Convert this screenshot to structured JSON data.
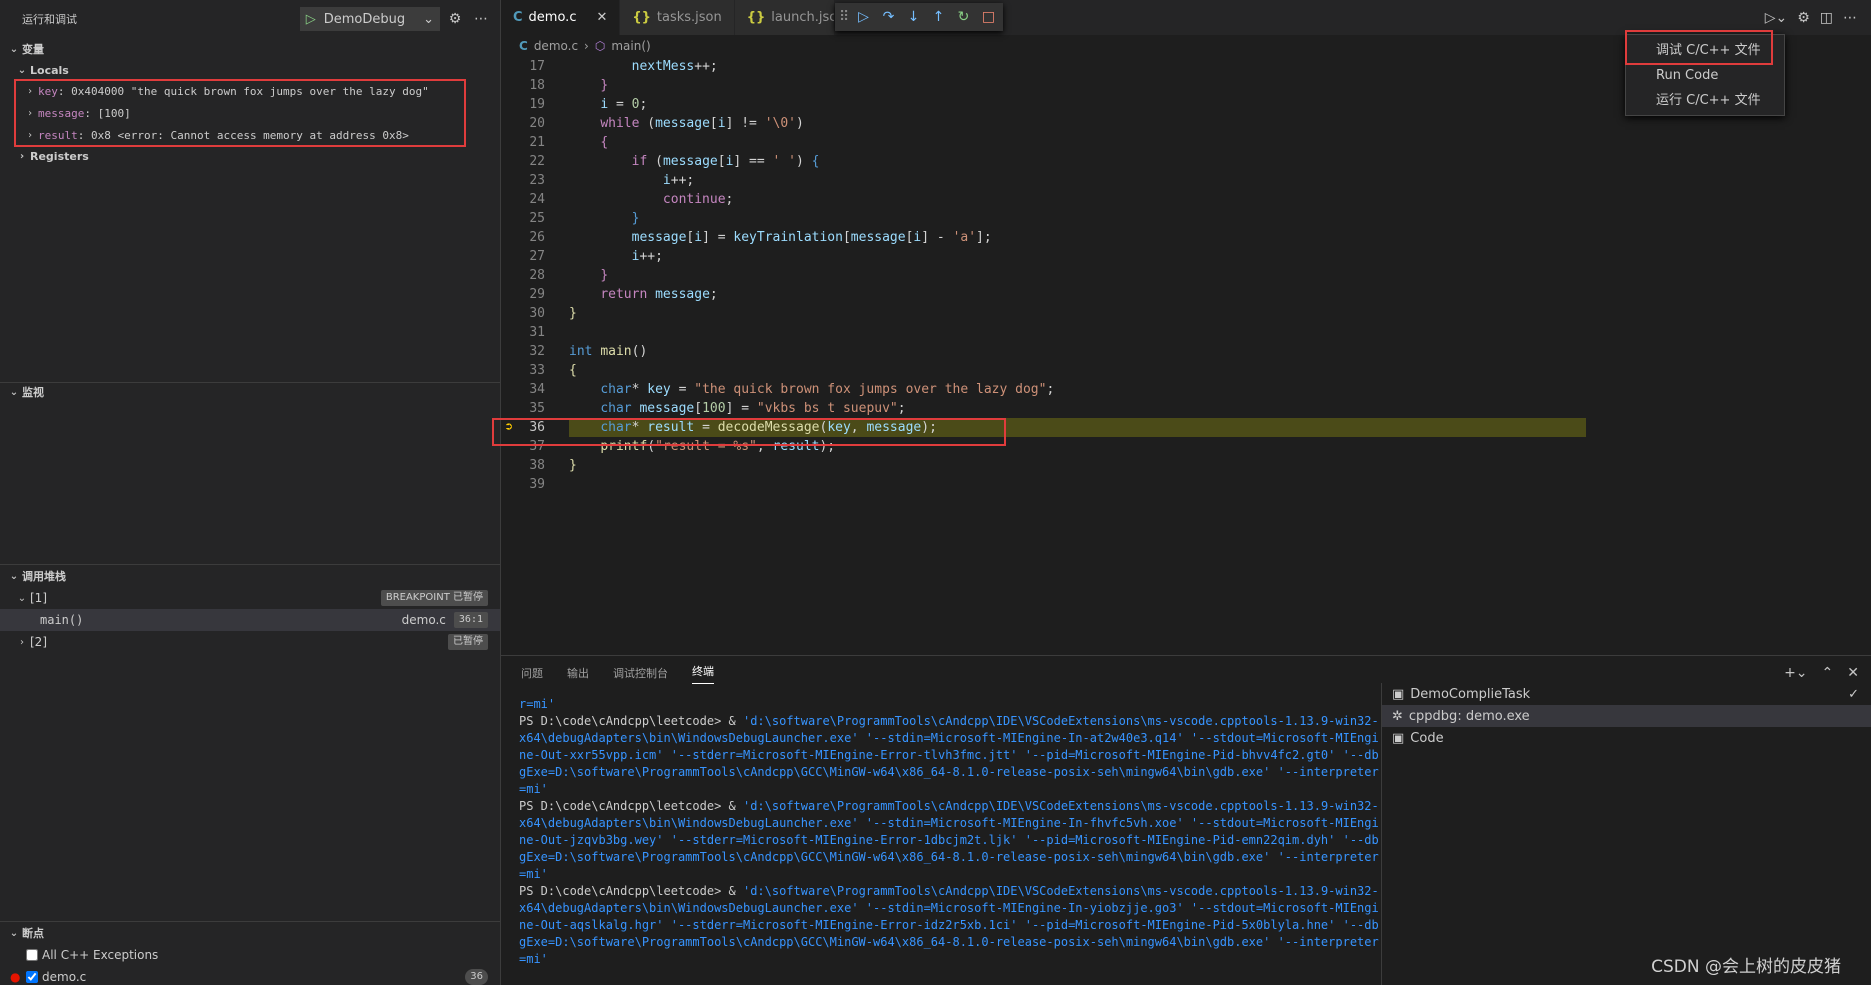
{
  "sidebar": {
    "title": "运行和调试",
    "config_name": "DemoDebug",
    "variables_header": "变量",
    "locals_label": "Locals",
    "locals": [
      {
        "name": "key",
        "value": "0x404000 \"the quick brown fox jumps over the lazy dog\""
      },
      {
        "name": "message",
        "value": "[100]"
      },
      {
        "name": "result",
        "value": "0x8 <error: Cannot access memory at address 0x8>"
      }
    ],
    "registers_label": "Registers",
    "watch_header": "监视",
    "callstack_header": "调用堆栈",
    "threads": [
      {
        "label": "[1]",
        "status": "BREAKPOINT 已暂停"
      },
      {
        "label": "[2]",
        "status": "已暂停"
      }
    ],
    "frame": {
      "name": "main()",
      "file": "demo.c",
      "pos": "36:1"
    },
    "breakpoints_header": "断点",
    "breakpoints": [
      {
        "label": "All C++ Exceptions",
        "checked": false
      },
      {
        "label": "demo.c",
        "checked": true,
        "count": "36"
      }
    ]
  },
  "tabs": [
    {
      "label": "demo.c"
    },
    {
      "label": "tasks.json"
    },
    {
      "label": "launch.jsc"
    }
  ],
  "breadcrumb": {
    "file": "demo.c",
    "symbol": "main()"
  },
  "code_lines": [
    {
      "n": "17"
    },
    {
      "n": "18"
    },
    {
      "n": "19"
    },
    {
      "n": "20"
    },
    {
      "n": "21"
    },
    {
      "n": "22"
    },
    {
      "n": "23"
    },
    {
      "n": "24"
    },
    {
      "n": "25"
    },
    {
      "n": "26"
    },
    {
      "n": "27"
    },
    {
      "n": "28"
    },
    {
      "n": "29"
    },
    {
      "n": "30"
    },
    {
      "n": "31"
    },
    {
      "n": "32"
    },
    {
      "n": "33"
    },
    {
      "n": "34"
    },
    {
      "n": "35"
    },
    {
      "n": "36"
    },
    {
      "n": "37"
    },
    {
      "n": "38"
    },
    {
      "n": "39"
    }
  ],
  "run_menu": {
    "items": [
      "调试 C/C++ 文件",
      "Run Code",
      "运行 C/C++ 文件"
    ]
  },
  "panel": {
    "tabs": [
      "问题",
      "输出",
      "调试控制台",
      "终端"
    ],
    "terminal": [
      {
        "prompt": "",
        "text": "r=mi'"
      },
      {
        "prompt": "PS D:\\code\\cAndcpp\\leetcode>  & ",
        "text": "'d:\\software\\ProgrammTools\\cAndcpp\\IDE\\VSCodeExtensions\\ms-vscode.cpptools-1.13.9-win32-x64\\debugAdapters\\bin\\WindowsDebugLauncher.exe' '--stdin=Microsoft-MIEngine-In-at2w40e3.q14' '--stdout=Microsoft-MIEngine-Out-xxr55vpp.icm' '--stderr=Microsoft-MIEngine-Error-tlvh3fmc.jtt' '--pid=Microsoft-MIEngine-Pid-bhvv4fc2.gt0' '--dbgExe=D:\\software\\ProgrammTools\\cAndcpp\\GCC\\MinGW-w64\\x86_64-8.1.0-release-posix-seh\\mingw64\\bin\\gdb.exe' '--interpreter=mi'"
      },
      {
        "prompt": "PS D:\\code\\cAndcpp\\leetcode>  & ",
        "text": "'d:\\software\\ProgrammTools\\cAndcpp\\IDE\\VSCodeExtensions\\ms-vscode.cpptools-1.13.9-win32-x64\\debugAdapters\\bin\\WindowsDebugLauncher.exe' '--stdin=Microsoft-MIEngine-In-fhvfc5vh.xoe' '--stdout=Microsoft-MIEngine-Out-jzqvb3bg.wey' '--stderr=Microsoft-MIEngine-Error-1dbcjm2t.ljk' '--pid=Microsoft-MIEngine-Pid-emn22qim.dyh' '--dbgExe=D:\\software\\ProgrammTools\\cAndcpp\\GCC\\MinGW-w64\\x86_64-8.1.0-release-posix-seh\\mingw64\\bin\\gdb.exe' '--interpreter=mi'"
      },
      {
        "prompt": "PS D:\\code\\cAndcpp\\leetcode>  & ",
        "text": "'d:\\software\\ProgrammTools\\cAndcpp\\IDE\\VSCodeExtensions\\ms-vscode.cpptools-1.13.9-win32-x64\\debugAdapters\\bin\\WindowsDebugLauncher.exe' '--stdin=Microsoft-MIEngine-In-yiobzjje.go3' '--stdout=Microsoft-MIEngine-Out-aqslkalg.hgr' '--stderr=Microsoft-MIEngine-Error-idz2r5xb.1ci' '--pid=Microsoft-MIEngine-Pid-5x0blyla.hne' '--dbgExe=D:\\software\\ProgrammTools\\cAndcpp\\GCC\\MinGW-w64\\x86_64-8.1.0-release-posix-seh\\mingw64\\bin\\gdb.exe' '--interpreter=mi'"
      }
    ],
    "terminal_list": [
      "DemoComplieTask",
      "cppdbg: demo.exe",
      "Code"
    ]
  },
  "watermark": "CSDN @会上树的皮皮猪",
  "colors": {
    "highlight": "#4b4b18",
    "annotation": "#e03c3c",
    "accent": "#3794ff"
  }
}
